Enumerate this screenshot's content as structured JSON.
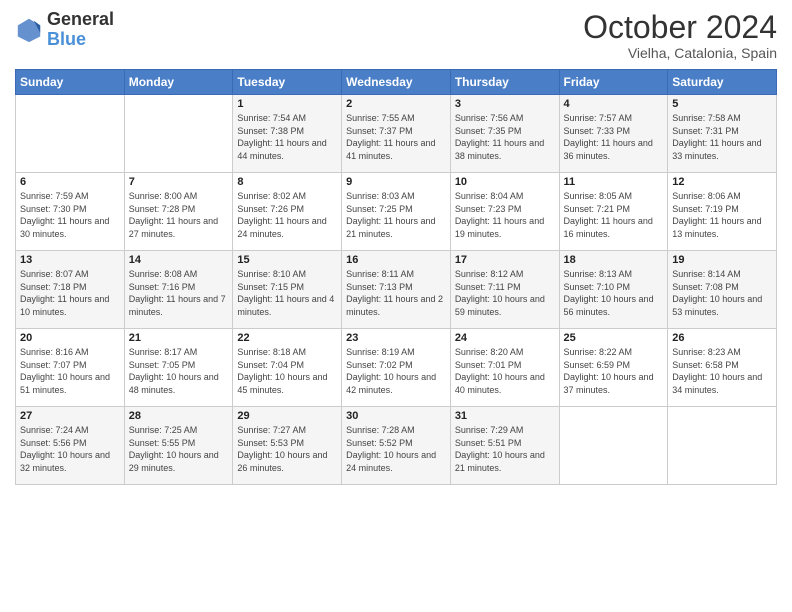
{
  "header": {
    "logo_line1": "General",
    "logo_line2": "Blue",
    "month": "October 2024",
    "location": "Vielha, Catalonia, Spain"
  },
  "days_of_week": [
    "Sunday",
    "Monday",
    "Tuesday",
    "Wednesday",
    "Thursday",
    "Friday",
    "Saturday"
  ],
  "weeks": [
    [
      {
        "day": "",
        "content": ""
      },
      {
        "day": "",
        "content": ""
      },
      {
        "day": "1",
        "content": "Sunrise: 7:54 AM\nSunset: 7:38 PM\nDaylight: 11 hours and 44 minutes."
      },
      {
        "day": "2",
        "content": "Sunrise: 7:55 AM\nSunset: 7:37 PM\nDaylight: 11 hours and 41 minutes."
      },
      {
        "day": "3",
        "content": "Sunrise: 7:56 AM\nSunset: 7:35 PM\nDaylight: 11 hours and 38 minutes."
      },
      {
        "day": "4",
        "content": "Sunrise: 7:57 AM\nSunset: 7:33 PM\nDaylight: 11 hours and 36 minutes."
      },
      {
        "day": "5",
        "content": "Sunrise: 7:58 AM\nSunset: 7:31 PM\nDaylight: 11 hours and 33 minutes."
      }
    ],
    [
      {
        "day": "6",
        "content": "Sunrise: 7:59 AM\nSunset: 7:30 PM\nDaylight: 11 hours and 30 minutes."
      },
      {
        "day": "7",
        "content": "Sunrise: 8:00 AM\nSunset: 7:28 PM\nDaylight: 11 hours and 27 minutes."
      },
      {
        "day": "8",
        "content": "Sunrise: 8:02 AM\nSunset: 7:26 PM\nDaylight: 11 hours and 24 minutes."
      },
      {
        "day": "9",
        "content": "Sunrise: 8:03 AM\nSunset: 7:25 PM\nDaylight: 11 hours and 21 minutes."
      },
      {
        "day": "10",
        "content": "Sunrise: 8:04 AM\nSunset: 7:23 PM\nDaylight: 11 hours and 19 minutes."
      },
      {
        "day": "11",
        "content": "Sunrise: 8:05 AM\nSunset: 7:21 PM\nDaylight: 11 hours and 16 minutes."
      },
      {
        "day": "12",
        "content": "Sunrise: 8:06 AM\nSunset: 7:19 PM\nDaylight: 11 hours and 13 minutes."
      }
    ],
    [
      {
        "day": "13",
        "content": "Sunrise: 8:07 AM\nSunset: 7:18 PM\nDaylight: 11 hours and 10 minutes."
      },
      {
        "day": "14",
        "content": "Sunrise: 8:08 AM\nSunset: 7:16 PM\nDaylight: 11 hours and 7 minutes."
      },
      {
        "day": "15",
        "content": "Sunrise: 8:10 AM\nSunset: 7:15 PM\nDaylight: 11 hours and 4 minutes."
      },
      {
        "day": "16",
        "content": "Sunrise: 8:11 AM\nSunset: 7:13 PM\nDaylight: 11 hours and 2 minutes."
      },
      {
        "day": "17",
        "content": "Sunrise: 8:12 AM\nSunset: 7:11 PM\nDaylight: 10 hours and 59 minutes."
      },
      {
        "day": "18",
        "content": "Sunrise: 8:13 AM\nSunset: 7:10 PM\nDaylight: 10 hours and 56 minutes."
      },
      {
        "day": "19",
        "content": "Sunrise: 8:14 AM\nSunset: 7:08 PM\nDaylight: 10 hours and 53 minutes."
      }
    ],
    [
      {
        "day": "20",
        "content": "Sunrise: 8:16 AM\nSunset: 7:07 PM\nDaylight: 10 hours and 51 minutes."
      },
      {
        "day": "21",
        "content": "Sunrise: 8:17 AM\nSunset: 7:05 PM\nDaylight: 10 hours and 48 minutes."
      },
      {
        "day": "22",
        "content": "Sunrise: 8:18 AM\nSunset: 7:04 PM\nDaylight: 10 hours and 45 minutes."
      },
      {
        "day": "23",
        "content": "Sunrise: 8:19 AM\nSunset: 7:02 PM\nDaylight: 10 hours and 42 minutes."
      },
      {
        "day": "24",
        "content": "Sunrise: 8:20 AM\nSunset: 7:01 PM\nDaylight: 10 hours and 40 minutes."
      },
      {
        "day": "25",
        "content": "Sunrise: 8:22 AM\nSunset: 6:59 PM\nDaylight: 10 hours and 37 minutes."
      },
      {
        "day": "26",
        "content": "Sunrise: 8:23 AM\nSunset: 6:58 PM\nDaylight: 10 hours and 34 minutes."
      }
    ],
    [
      {
        "day": "27",
        "content": "Sunrise: 7:24 AM\nSunset: 5:56 PM\nDaylight: 10 hours and 32 minutes."
      },
      {
        "day": "28",
        "content": "Sunrise: 7:25 AM\nSunset: 5:55 PM\nDaylight: 10 hours and 29 minutes."
      },
      {
        "day": "29",
        "content": "Sunrise: 7:27 AM\nSunset: 5:53 PM\nDaylight: 10 hours and 26 minutes."
      },
      {
        "day": "30",
        "content": "Sunrise: 7:28 AM\nSunset: 5:52 PM\nDaylight: 10 hours and 24 minutes."
      },
      {
        "day": "31",
        "content": "Sunrise: 7:29 AM\nSunset: 5:51 PM\nDaylight: 10 hours and 21 minutes."
      },
      {
        "day": "",
        "content": ""
      },
      {
        "day": "",
        "content": ""
      }
    ]
  ]
}
